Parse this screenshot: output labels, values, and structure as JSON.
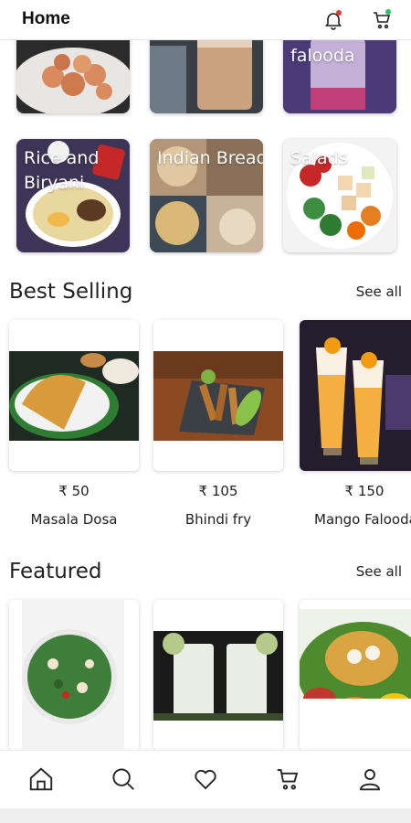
{
  "header": {
    "title": "Home",
    "bell_icon": "bell-icon",
    "cart_icon": "cart-icon",
    "bell_dot_color": "#e53935",
    "cart_dot_color": "#22c55e"
  },
  "categories": [
    {
      "label": "",
      "image": "shrimp-plate"
    },
    {
      "label": "",
      "image": "masala-chai"
    },
    {
      "label": "falooda",
      "image": "falooda-glass"
    },
    {
      "label": "Rice and Biryani",
      "image": "biryani-plate"
    },
    {
      "label": "Indian Bread",
      "image": "indian-bread-collage"
    },
    {
      "label": "Salads",
      "image": "salad-bowl"
    }
  ],
  "best_selling": {
    "title": "Best Selling",
    "see_all": "See all",
    "items": [
      {
        "price": "₹ 50",
        "name": "Masala Dosa",
        "image": "masala-dosa"
      },
      {
        "price": "₹ 105",
        "name": "Bhindi fry",
        "image": "bhindi-fry"
      },
      {
        "price": "₹ 150",
        "name": "Mango Falooda",
        "image": "mango-falooda"
      }
    ]
  },
  "featured": {
    "title": "Featured",
    "see_all": "See all",
    "items": [
      {
        "image": "kale-salad"
      },
      {
        "image": "lassi-glasses"
      },
      {
        "image": "thali-platter"
      }
    ]
  },
  "bottom_nav": [
    {
      "name": "home",
      "icon": "home-icon"
    },
    {
      "name": "search",
      "icon": "search-icon"
    },
    {
      "name": "favorites",
      "icon": "heart-icon"
    },
    {
      "name": "cart",
      "icon": "cart-icon"
    },
    {
      "name": "profile",
      "icon": "user-icon"
    }
  ]
}
